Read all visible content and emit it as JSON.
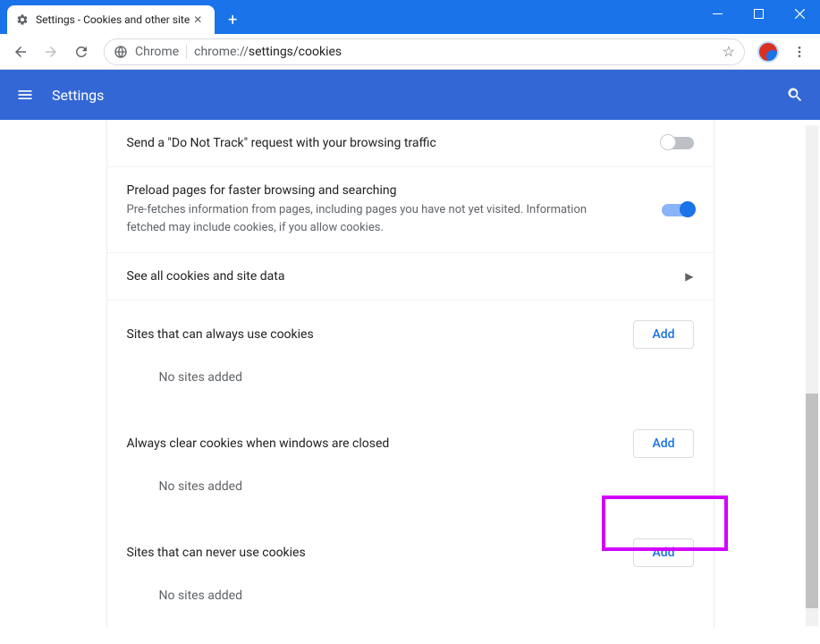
{
  "window": {
    "tab_title": "Settings - Cookies and other site"
  },
  "toolbar": {
    "origin_label": "Chrome",
    "url_scheme": "chrome://",
    "url_path": "settings/cookies"
  },
  "header": {
    "title": "Settings"
  },
  "rows": {
    "dnt": {
      "title": "Send a \"Do Not Track\" request with your browsing traffic",
      "enabled": false
    },
    "preload": {
      "title": "Preload pages for faster browsing and searching",
      "desc": "Pre-fetches information from pages, including pages you have not yet visited. Information fetched may include cookies, if you allow cookies.",
      "enabled": true
    },
    "see_all": {
      "title": "See all cookies and site data"
    }
  },
  "sections": {
    "always": {
      "title": "Sites that can always use cookies",
      "add_label": "Add",
      "empty": "No sites added"
    },
    "clear": {
      "title": "Always clear cookies when windows are closed",
      "add_label": "Add",
      "empty": "No sites added"
    },
    "never": {
      "title": "Sites that can never use cookies",
      "add_label": "Add",
      "empty": "No sites added"
    }
  }
}
